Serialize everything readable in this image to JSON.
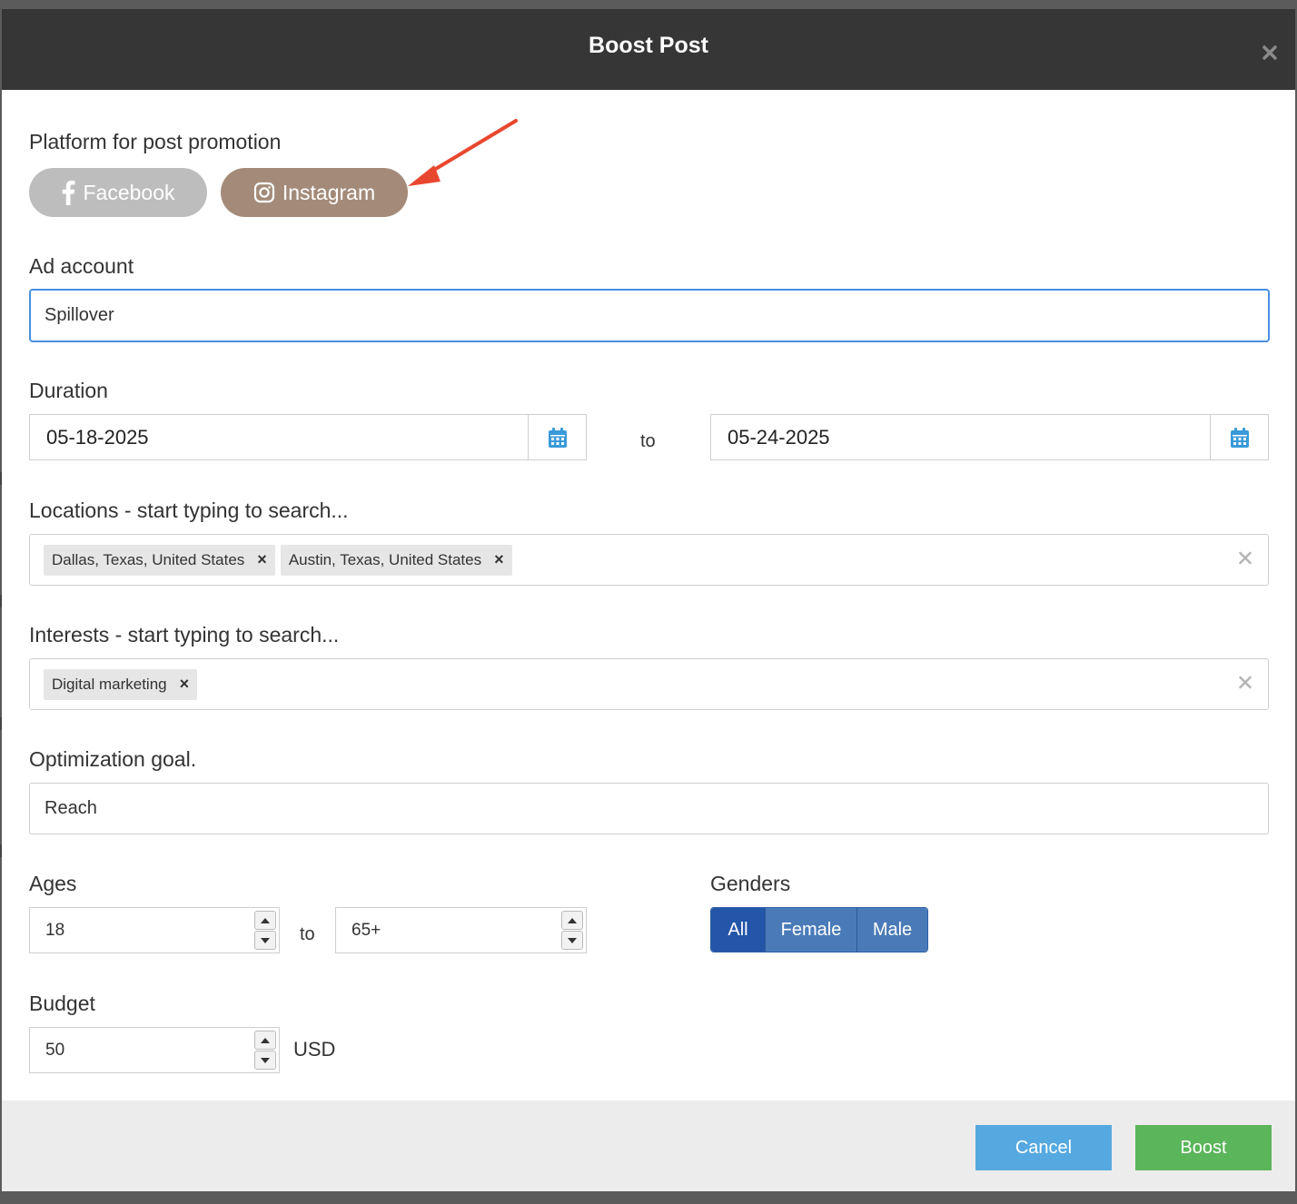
{
  "modal": {
    "title": "Boost Post"
  },
  "platform": {
    "label": "Platform for post promotion",
    "facebook_label": "Facebook",
    "instagram_label": "Instagram",
    "selected": "Instagram"
  },
  "ad_account": {
    "label": "Ad account",
    "value": "Spillover"
  },
  "duration": {
    "label": "Duration",
    "start": "05-18-2025",
    "end": "05-24-2025",
    "separator": "to"
  },
  "locations": {
    "label": "Locations - start typing to search...",
    "tags": [
      "Dallas, Texas, United States",
      "Austin, Texas, United States"
    ]
  },
  "interests": {
    "label": "Interests - start typing to search...",
    "tags": [
      "Digital marketing"
    ]
  },
  "optimization": {
    "label": "Optimization goal.",
    "value": "Reach"
  },
  "ages": {
    "label": "Ages",
    "min": "18",
    "max": "65+",
    "separator": "to"
  },
  "genders": {
    "label": "Genders",
    "options": [
      "All",
      "Female",
      "Male"
    ],
    "selected": "All"
  },
  "budget": {
    "label": "Budget",
    "value": "50",
    "currency": "USD"
  },
  "footer": {
    "cancel_label": "Cancel",
    "boost_label": "Boost"
  },
  "colors": {
    "header_bg": "#363636",
    "instagram_pill": "#a48b79",
    "facebook_pill": "#bdbdbd",
    "focus_border": "#4a8fe0",
    "gender_active": "#2355a8",
    "cancel": "#55a9e0",
    "boost": "#5bb55b",
    "annotation_arrow": "#e8472f"
  },
  "icons": [
    "facebook-icon",
    "instagram-icon",
    "calendar-icon",
    "close-icon",
    "spinner-up-icon",
    "spinner-down-icon",
    "annotation-arrow"
  ]
}
